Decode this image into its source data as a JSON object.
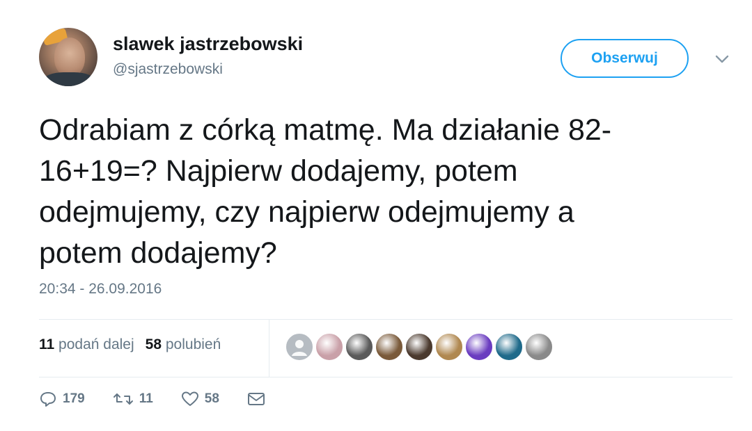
{
  "user": {
    "name": "slawek jastrzebowski",
    "handle": "@sjastrzebowski"
  },
  "follow_button": {
    "label": "Obserwuj"
  },
  "tweet": {
    "text": "Odrabiam z córką matmę. Ma działanie 82-\n16+19=? Najpierw dodajemy, potem\nodejmujemy, czy najpierw odejmujemy a\npotem dodajemy?",
    "timestamp": "20:34 - 26.09.2016"
  },
  "stats": {
    "retweets_count": "11",
    "retweets_label": "podań dalej",
    "likes_count": "58",
    "likes_label": "polubień"
  },
  "likers": [
    {
      "color": "#b6bcc2"
    },
    {
      "color": "#c9a0a8"
    },
    {
      "color": "#5a5a5a"
    },
    {
      "color": "#7a5a3a"
    },
    {
      "color": "#4b3a2e"
    },
    {
      "color": "#b08850"
    },
    {
      "color": "#6a3cc0"
    },
    {
      "color": "#1f6a8a"
    },
    {
      "color": "#8a8a8a"
    }
  ],
  "actions": {
    "replies": "179",
    "retweets": "11",
    "likes": "58"
  },
  "icons": {
    "reply": "reply-icon",
    "retweet": "retweet-icon",
    "like": "heart-icon",
    "dm": "envelope-icon",
    "more": "chevron-down-icon"
  }
}
